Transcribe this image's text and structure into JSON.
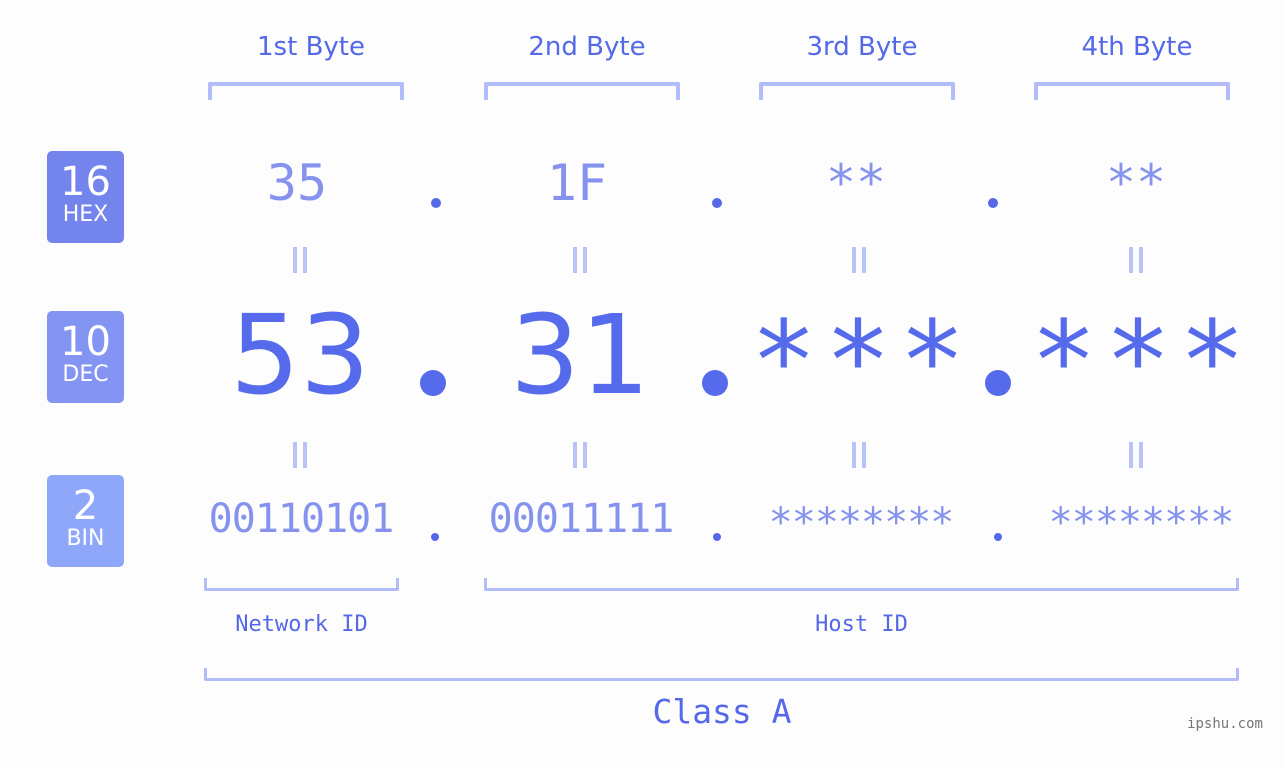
{
  "headers": [
    "1st Byte",
    "2nd Byte",
    "3rd Byte",
    "4th Byte"
  ],
  "badges": {
    "hex": {
      "num": "16",
      "label": "HEX",
      "color": "#7384ec"
    },
    "dec": {
      "num": "10",
      "label": "DEC",
      "color": "#8494f2"
    },
    "bin": {
      "num": "2",
      "label": "BIN",
      "color": "#8fa7f8"
    }
  },
  "hex": [
    "35",
    "1F",
    "**",
    "**"
  ],
  "dec": [
    "53",
    "31",
    "***",
    "***"
  ],
  "bin": [
    "00110101",
    "00011111",
    "********",
    "********"
  ],
  "labels": {
    "network_id": "Network ID",
    "host_id": "Host ID",
    "class": "Class A"
  },
  "watermark": "ipshu.com",
  "colors": {
    "accent": "#566bec",
    "light_accent": "#8592ee",
    "bracket": "#b1bcf8",
    "background": "#fcfdfc"
  }
}
